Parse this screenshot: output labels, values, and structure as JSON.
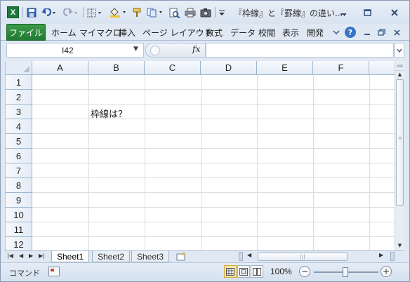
{
  "titlebar": {
    "app_icon_label": "X",
    "document_title": "『枠線』と『罫線』の違い....",
    "qat_icons": [
      "save-icon",
      "undo-icon",
      "redo-icon",
      "borders-icon",
      "fill-color-icon",
      "format-painter-icon",
      "copy-icon",
      "print-preview-icon",
      "print-icon",
      "camera-icon",
      "customize-qat-icon"
    ],
    "window_buttons": {
      "minimize": "–",
      "maximize": "☐",
      "close": "✕"
    }
  },
  "ribbon": {
    "file_tab": "ファイル",
    "tabs": [
      "ホーム",
      "マイマクロ",
      "挿入",
      "ページ レイアウト",
      "数式",
      "データ",
      "校閲",
      "表示",
      "開発"
    ],
    "help": "?"
  },
  "formula_bar": {
    "name_box": "I42",
    "fx_label": "fx",
    "formula_value": ""
  },
  "grid": {
    "columns": [
      "A",
      "B",
      "C",
      "D",
      "E",
      "F"
    ],
    "rows": [
      "1",
      "2",
      "3",
      "4",
      "5",
      "6",
      "7",
      "8",
      "9",
      "10",
      "11",
      "12"
    ],
    "cell_B3": "枠線は？"
  },
  "sheets": {
    "tabs": [
      "Sheet1",
      "Sheet2",
      "Sheet3"
    ],
    "active": "Sheet1"
  },
  "status": {
    "mode": "コマンド",
    "zoom": "100%",
    "zoom_level_percent": 100,
    "zoom_minus": "−",
    "zoom_plus": "+"
  }
}
